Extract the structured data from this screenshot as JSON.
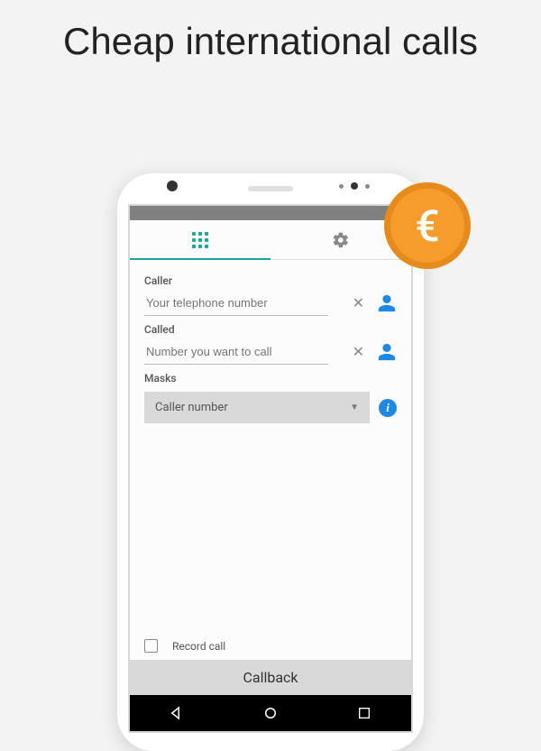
{
  "headline": "Cheap international calls",
  "coin_symbol": "€",
  "form": {
    "caller_label": "Caller",
    "caller_placeholder": "Your telephone number",
    "called_label": "Called",
    "called_placeholder": "Number you want to call",
    "masks_label": "Masks",
    "masks_selected": "Caller number",
    "record_label": "Record call",
    "submit_label": "Callback"
  }
}
